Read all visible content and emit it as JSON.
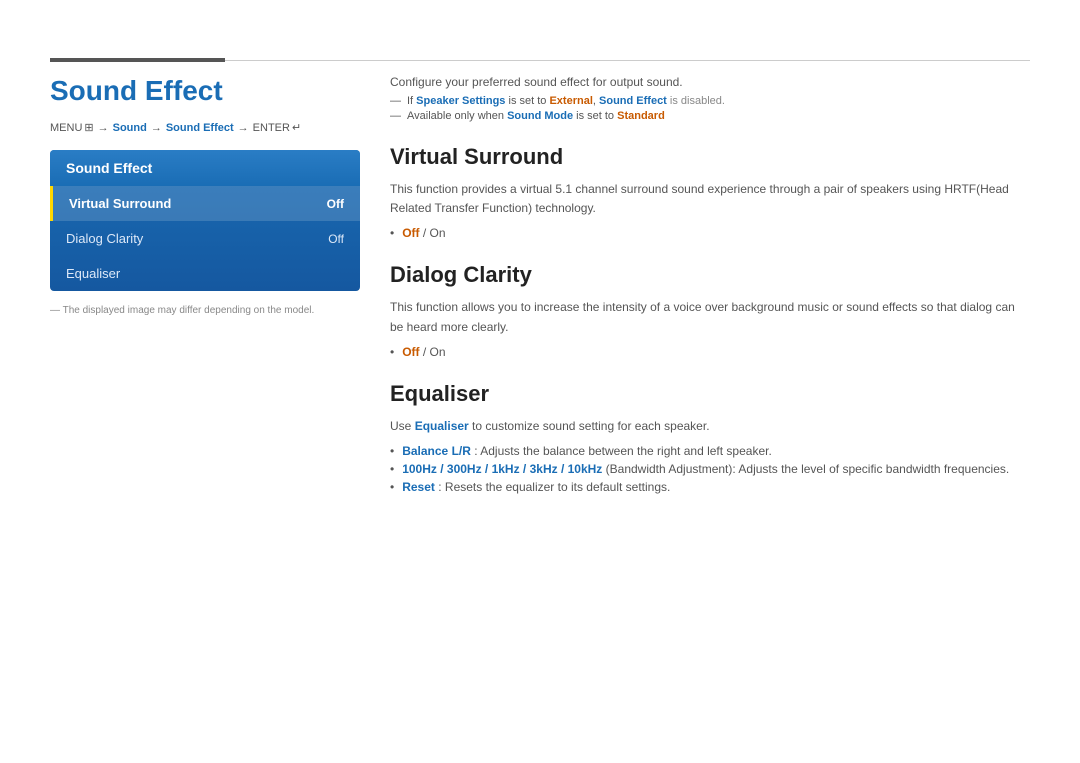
{
  "top_accent": {
    "color": "#555555"
  },
  "left": {
    "page_title": "Sound Effect",
    "breadcrumb": {
      "menu": "MENU",
      "arrow1": "→",
      "sound": "Sound",
      "arrow2": "→",
      "sound_effect": "Sound Effect",
      "arrow3": "→",
      "enter": "ENTER"
    },
    "menu_box": {
      "header": "Sound Effect",
      "items": [
        {
          "label": "Virtual Surround",
          "value": "Off",
          "active": true
        },
        {
          "label": "Dialog Clarity",
          "value": "Off",
          "active": false
        },
        {
          "label": "Equaliser",
          "value": "",
          "active": false
        }
      ]
    },
    "footnote": "The displayed image may differ depending on the model."
  },
  "right": {
    "intro": "Configure your preferred sound effect for output sound.",
    "note1_prefix": "If ",
    "note1_link": "Speaker Settings",
    "note1_mid": " is set to ",
    "note1_value": "External",
    "note1_link2": "Sound Effect",
    "note1_suffix": " is disabled.",
    "note2_prefix": "Available only when ",
    "note2_link": "Sound Mode",
    "note2_mid": " is set to ",
    "note2_value": "Standard",
    "sections": [
      {
        "id": "virtual-surround",
        "title": "Virtual Surround",
        "body": "This function provides a virtual 5.1 channel surround sound experience through a pair of speakers using HRTF(Head Related Transfer Function) technology.",
        "bullets": [
          {
            "text": "Off / On",
            "type": "orange-slash"
          }
        ]
      },
      {
        "id": "dialog-clarity",
        "title": "Dialog Clarity",
        "body": "This function allows you to increase the intensity of a voice over background music or sound effects so that dialog can be heard more clearly.",
        "bullets": [
          {
            "text": "Off / On",
            "type": "orange-slash"
          }
        ]
      },
      {
        "id": "equaliser",
        "title": "Equaliser",
        "intro": "Use ",
        "intro_link": "Equaliser",
        "intro_suffix": " to customize sound setting for each speaker.",
        "bullets": [
          {
            "bold_part": "Balance L/R",
            "normal_part": ": Adjusts the balance between the right and left speaker.",
            "type": "blue-normal"
          },
          {
            "bold_part": "100Hz / 300Hz / 1kHz / 3kHz / 10kHz",
            "normal_part": " (Bandwidth Adjustment): Adjusts the level of specific bandwidth frequencies.",
            "type": "blue-normal"
          },
          {
            "bold_part": "Reset",
            "normal_part": ": Resets the equalizer to its default settings.",
            "type": "blue-normal"
          }
        ]
      }
    ]
  },
  "colors": {
    "blue": "#1a6db5",
    "orange": "#c85a00",
    "accent_bar": "#555555"
  }
}
